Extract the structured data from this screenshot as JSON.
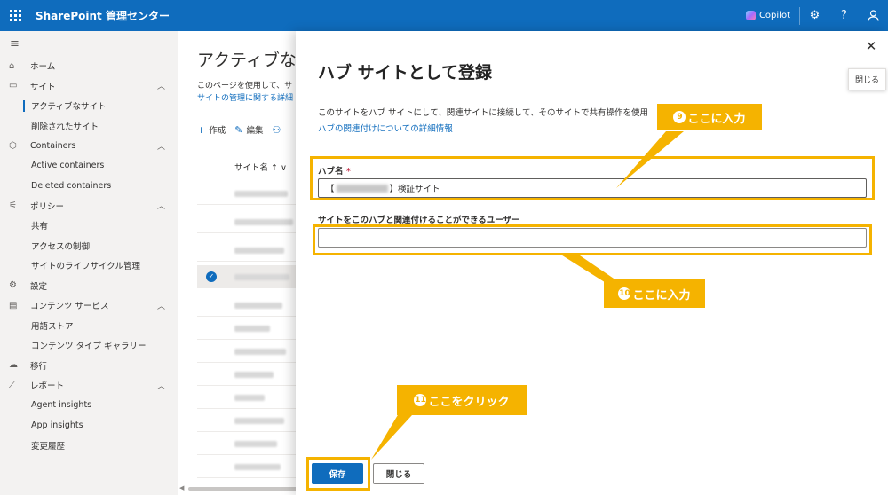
{
  "topbar": {
    "app_title": "SharePoint 管理センター",
    "copilot_label": "Copilot",
    "icons": [
      "waffle-icon",
      "gear-icon",
      "help-icon",
      "person-icon"
    ],
    "help_glyph": "?",
    "bg_color": "#0f6cbd"
  },
  "nav": {
    "home": "ホーム",
    "sites": "サイト",
    "active_sites": "アクティブなサイト",
    "deleted_sites": "削除されたサイト",
    "containers": "Containers",
    "active_containers": "Active containers",
    "deleted_containers": "Deleted containers",
    "policies": "ポリシー",
    "sharing": "共有",
    "access_control": "アクセスの制御",
    "site_lifecycle": "サイトのライフサイクル管理",
    "settings": "設定",
    "content_services": "コンテンツ サービス",
    "term_store": "用語ストア",
    "content_type_gallery": "コンテンツ タイプ ギャラリー",
    "migration": "移行",
    "reports": "レポート",
    "agent_insights": "Agent insights",
    "app_insights": "App insights",
    "change_history": "変更履歴"
  },
  "main": {
    "title": "アクティブな",
    "desc_line1": "このページを使用して、サ",
    "desc_line2": "サイトの管理に関する詳細",
    "cmd_create": "作成",
    "cmd_edit": "編集",
    "col_site_name": "サイト名 ↑ ∨"
  },
  "panel": {
    "close_tooltip": "閉じる",
    "title": "ハブ サイトとして登録",
    "description": "このサイトをハブ サイトにして、関連サイトに接続して、そのサイトで共有操作を使用",
    "link": "ハブの関連付けについての詳細情報",
    "hub_name_label": "ハブ名",
    "required_mark": "*",
    "hub_name_prefix": "【",
    "hub_name_suffix": "】検証サイト",
    "users_label": "サイトをこのハブと関連付けることができるユーザー",
    "users_value": "",
    "save_button": "保存",
    "close_button": "閉じる"
  },
  "annotations": {
    "callout9_num": "9",
    "callout9_text": "ここに入力",
    "callout10_num": "10",
    "callout10_text": "ここに入力",
    "callout11_num": "11",
    "callout11_text": "ここをクリック",
    "color": "#f5b300"
  }
}
